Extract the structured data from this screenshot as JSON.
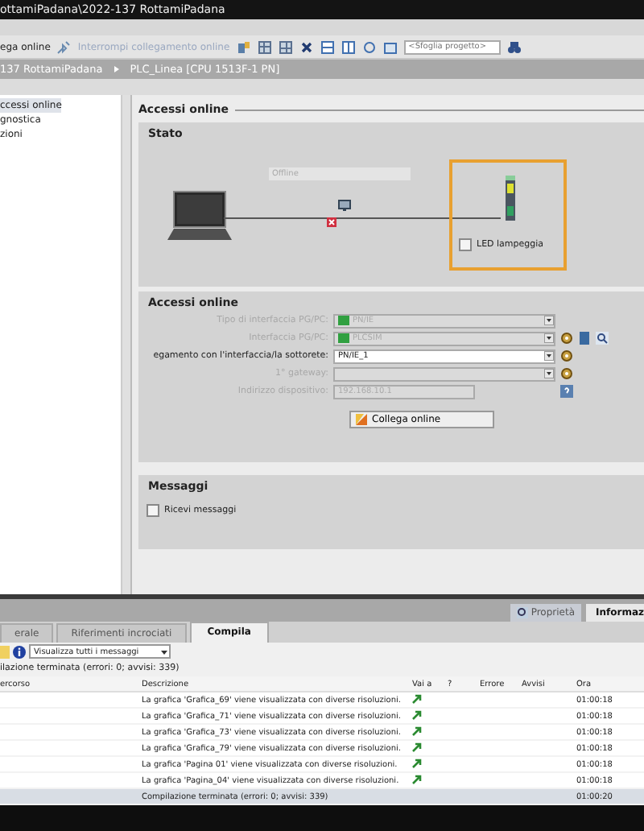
{
  "window": {
    "title": "ottamiPadana\\2022-137 RottamiPadana"
  },
  "toolbar": {
    "items": [
      {
        "label": "ega online",
        "disabled": false
      },
      {
        "label": "Interrompi collegamento online",
        "disabled": true
      }
    ],
    "search": {
      "placeholder": "<Sfoglia progetto>"
    }
  },
  "breadcrumb": [
    "137 RottamiPadana",
    "PLC_Linea [CPU 1513F-1 PN]"
  ],
  "nav": {
    "items": [
      {
        "label": "ccessi online",
        "selected": true
      },
      {
        "label": "gnostica",
        "selected": false
      },
      {
        "label": "zioni",
        "selected": false
      }
    ]
  },
  "editor": {
    "heading": "Accessi online",
    "stato": {
      "title": "Stato",
      "status": "Offline",
      "led": {
        "label": "LED lampeggia",
        "checked": false
      }
    },
    "access": {
      "title": "Accessi online",
      "fields": [
        {
          "kind": "select",
          "label": "Tipo di interfaccia PG/PC:",
          "value": "PN/IE",
          "disabled": true
        },
        {
          "kind": "select",
          "label": "Interfaccia PG/PC:",
          "value": "PLCSIM",
          "disabled": true
        },
        {
          "kind": "select",
          "label": "egamento con l'interfaccia/la sottorete:",
          "value": "PN/IE_1",
          "disabled": false
        },
        {
          "kind": "select",
          "label": "1° gateway:",
          "disabled": true
        },
        {
          "kind": "text",
          "label": "Indirizzo dispositivo:",
          "value": "192.168.10.1",
          "disabled": true
        }
      ],
      "button": "Collega online"
    },
    "messages": {
      "title": "Messaggi",
      "checkbox": {
        "label": "Ricevi messaggi",
        "checked": false
      }
    }
  },
  "inspector_tabs": [
    {
      "label": "Proprietà",
      "selected": false
    },
    {
      "label": "Informaz",
      "selected": true
    }
  ],
  "tabs": [
    {
      "label": "erale",
      "selected": false
    },
    {
      "label": "Riferimenti incrociati",
      "selected": false
    },
    {
      "label": "Compila",
      "selected": true
    }
  ],
  "filter": {
    "value": "Visualizza tutti i messaggi"
  },
  "summary": "ilazione terminata (errori: 0; avvisi: 339)",
  "table": {
    "columns": [
      "ercorso",
      "Descrizione",
      "Vai a",
      "?",
      "Errore",
      "Avvisi",
      "Ora"
    ],
    "rows": [
      {
        "description": "La grafica 'Grafica_69' viene visualizzata con diverse risoluzioni.",
        "goto": true,
        "time": "01:00:18",
        "selected": false
      },
      {
        "description": "La grafica 'Grafica_71' viene visualizzata con diverse risoluzioni.",
        "goto": true,
        "time": "01:00:18",
        "selected": false
      },
      {
        "description": "La grafica 'Grafica_73' viene visualizzata con diverse risoluzioni.",
        "goto": true,
        "time": "01:00:18",
        "selected": false
      },
      {
        "description": "La grafica 'Grafica_79' viene visualizzata con diverse risoluzioni.",
        "goto": true,
        "time": "01:00:18",
        "selected": false
      },
      {
        "description": "La grafica 'Pagina 01' viene visualizzata con diverse risoluzioni.",
        "goto": true,
        "time": "01:00:18",
        "selected": false
      },
      {
        "description": "La grafica 'Pagina_04' viene visualizzata con diverse risoluzioni.",
        "goto": true,
        "time": "01:00:18",
        "selected": false
      },
      {
        "description": "Compilazione terminata (errori: 0; avvisi: 339)",
        "goto": false,
        "time": "01:00:20",
        "selected": true
      }
    ]
  }
}
